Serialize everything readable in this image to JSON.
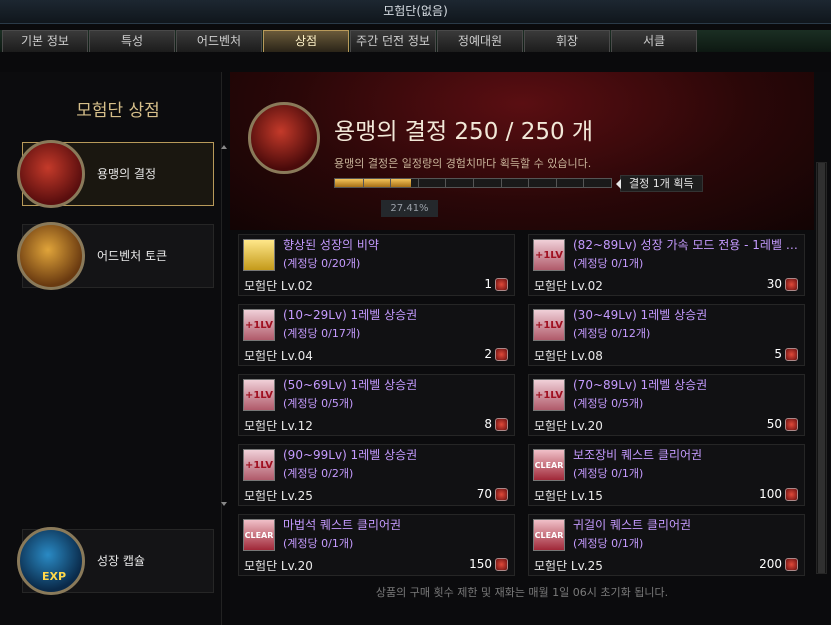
{
  "window": {
    "title": "모험단(없음)"
  },
  "tabs": [
    {
      "label": "기본 정보"
    },
    {
      "label": "특성"
    },
    {
      "label": "어드벤처"
    },
    {
      "label": "상점",
      "active": true
    },
    {
      "label": "주간 던전 정보"
    },
    {
      "label": "정예대원"
    },
    {
      "label": "휘장"
    },
    {
      "label": "서클"
    }
  ],
  "help": {
    "label": "?"
  },
  "sidebar": {
    "title": "모험단 상점",
    "items": [
      {
        "label": "용맹의 결정",
        "icon": "crystal-fist-icon",
        "active": true
      },
      {
        "label": "어드벤처 토큰",
        "icon": "treasure-chest-icon",
        "active": false
      }
    ],
    "bottom_item": {
      "label": "성장 캡슐",
      "icon": "exp-capsule-icon"
    }
  },
  "banner": {
    "title": "용맹의 결정 250 / 250 개",
    "description": "용맹의 결정은 일정량의 경험치마다 획득할 수 있습니다.",
    "gauge_fraction": 0.2741,
    "gauge_label": "결정 1개 획득",
    "percent": "27.41%"
  },
  "items": [
    {
      "name": "향상된 성장의 비약",
      "limit": "(계정당 0/20개)",
      "level": "모험단 Lv.02",
      "price": "1",
      "icon": "potion-icon"
    },
    {
      "name": "(82~89Lv) 성장 가속 모드 전용 - 1레벨 상...",
      "limit": "(계정당 0/1개)",
      "level": "모험단 Lv.02",
      "price": "30",
      "icon": "level-up-ticket-icon"
    },
    {
      "name": "(10~29Lv) 1레벨 상승권",
      "limit": "(계정당 0/17개)",
      "level": "모험단 Lv.04",
      "price": "2",
      "icon": "level-up-ticket-icon"
    },
    {
      "name": "(30~49Lv) 1레벨 상승권",
      "limit": "(계정당 0/12개)",
      "level": "모험단 Lv.08",
      "price": "5",
      "icon": "level-up-ticket-icon"
    },
    {
      "name": "(50~69Lv) 1레벨 상승권",
      "limit": "(계정당 0/5개)",
      "level": "모험단 Lv.12",
      "price": "8",
      "icon": "level-up-ticket-icon"
    },
    {
      "name": "(70~89Lv) 1레벨 상승권",
      "limit": "(계정당 0/5개)",
      "level": "모험단 Lv.20",
      "price": "50",
      "icon": "level-up-ticket-icon"
    },
    {
      "name": "(90~99Lv) 1레벨 상승권",
      "limit": "(계정당 0/2개)",
      "level": "모험단 Lv.25",
      "price": "70",
      "icon": "level-up-ticket-icon"
    },
    {
      "name": "보조장비 퀘스트 클리어권",
      "limit": "(계정당 0/1개)",
      "level": "모험단 Lv.15",
      "price": "100",
      "icon": "quest-clear-ticket-icon"
    },
    {
      "name": "마법석 퀘스트 클리어권",
      "limit": "(계정당 0/1개)",
      "level": "모험단 Lv.20",
      "price": "150",
      "icon": "quest-clear-ticket-icon"
    },
    {
      "name": "귀걸이 퀘스트 클리어권",
      "limit": "(계정당 0/1개)",
      "level": "모험단 Lv.25",
      "price": "200",
      "icon": "quest-clear-ticket-icon"
    }
  ],
  "icon_glyphs": {
    "level_up": "+1LV",
    "quest_clear": "CLEAR",
    "exp": "EXP"
  },
  "footer": {
    "text": "상품의 구매 횟수 제한 및 재화는 매월 1일 06시 초기화 됩니다."
  },
  "colors": {
    "accent_gold": "#b89a5a",
    "item_name": "#c59bff",
    "banner_red": "#5a0e12",
    "gauge_fill": "#f3c35a"
  }
}
